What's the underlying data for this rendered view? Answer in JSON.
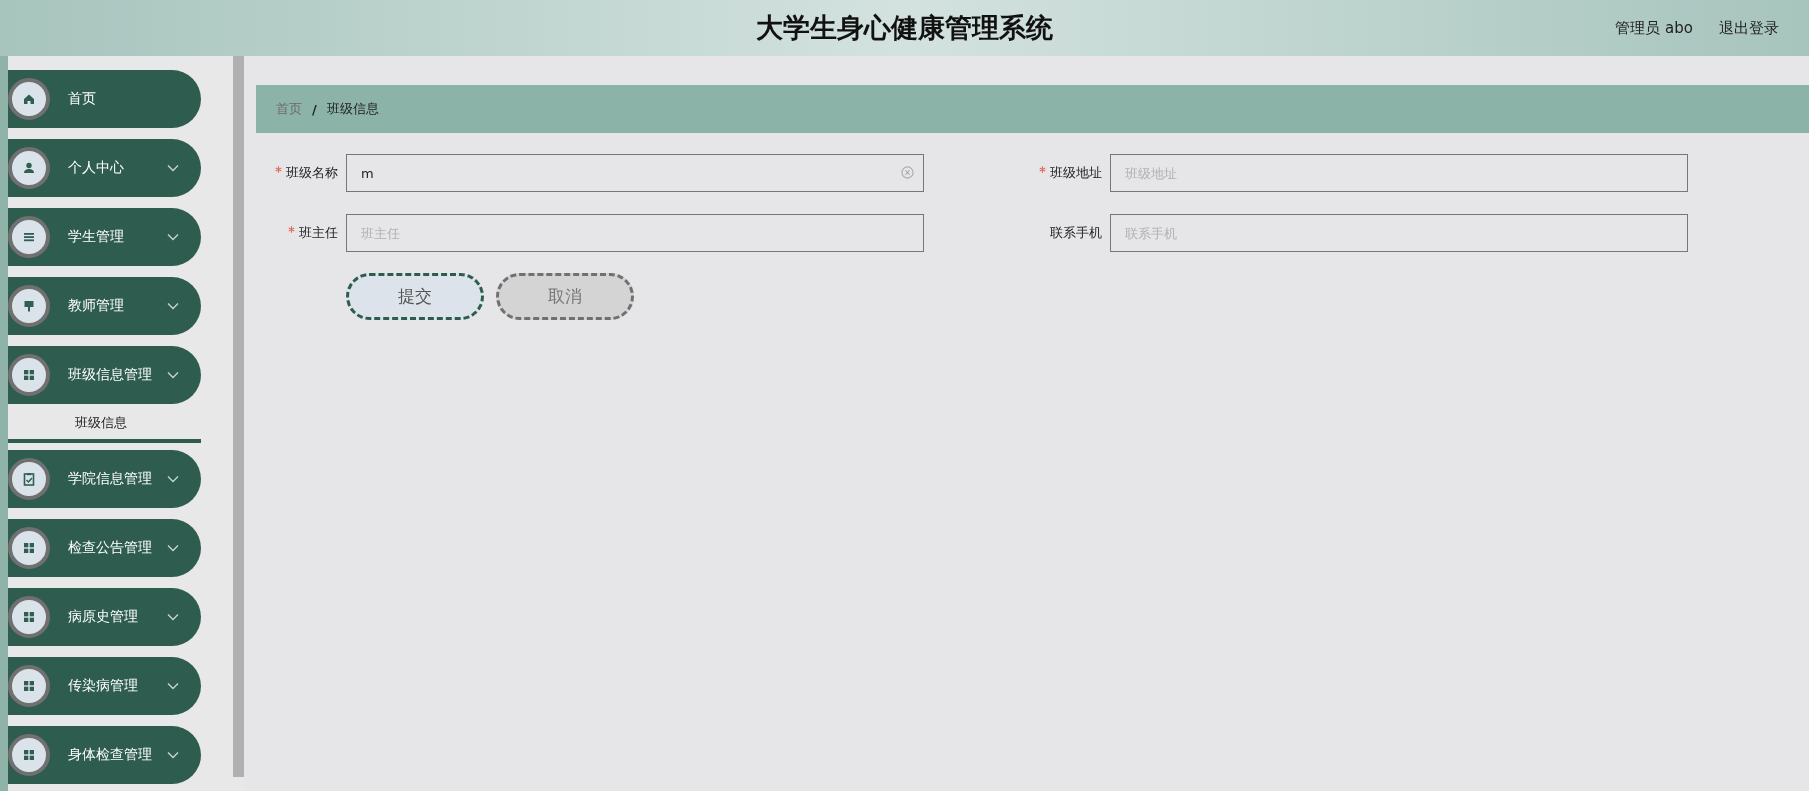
{
  "header": {
    "title": "大学生身心健康管理系统",
    "user": "管理员 abo",
    "logout": "退出登录"
  },
  "sidebar": {
    "items": [
      {
        "label": "首页",
        "kind": "link"
      },
      {
        "label": "个人中心",
        "kind": "menu"
      },
      {
        "label": "学生管理",
        "kind": "menu"
      },
      {
        "label": "教师管理",
        "kind": "menu"
      },
      {
        "label": "班级信息管理",
        "kind": "menu",
        "children": [
          {
            "label": "班级信息",
            "selected": true
          }
        ]
      },
      {
        "label": "学院信息管理",
        "kind": "menu"
      },
      {
        "label": "检查公告管理",
        "kind": "menu"
      },
      {
        "label": "病原史管理",
        "kind": "menu"
      },
      {
        "label": "传染病管理",
        "kind": "menu"
      },
      {
        "label": "身体检查管理",
        "kind": "menu"
      }
    ]
  },
  "breadcrumb": {
    "items": [
      "首页",
      "班级信息"
    ],
    "separator": "/"
  },
  "form": {
    "fields": [
      {
        "label": "班级名称",
        "required": true,
        "value": "m"
      },
      {
        "label": "班级地址",
        "required": true,
        "placeholder": "班级地址"
      },
      {
        "label": "班主任",
        "required": true,
        "placeholder": "班主任"
      },
      {
        "label": "联系手机",
        "required": false,
        "placeholder": "联系手机"
      }
    ],
    "buttons": [
      {
        "label": "提交",
        "kind": "primary"
      },
      {
        "label": "取消",
        "kind": "secondary"
      }
    ]
  }
}
